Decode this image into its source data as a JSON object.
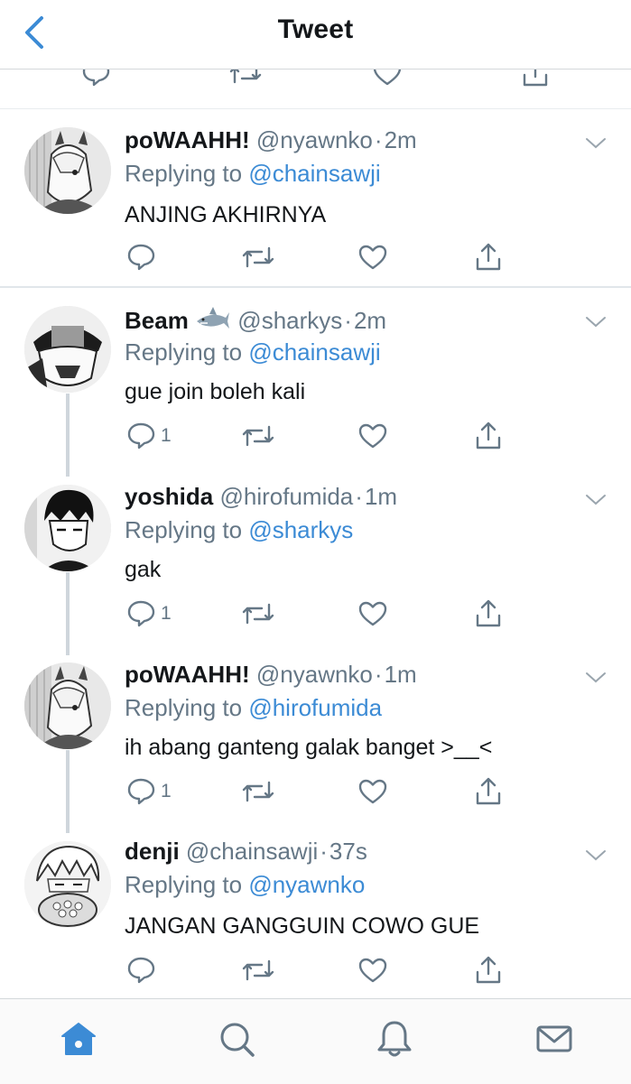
{
  "header": {
    "title": "Tweet"
  },
  "tweets": [
    {
      "name": "poWAAHH!",
      "emoji": "",
      "handle": "@nyawnko",
      "time": "2m",
      "replying_prefix": "Replying to",
      "replying_to": "@chainsawji",
      "text": "ANJING AKHIRNYA",
      "reply_count": ""
    },
    {
      "name": "Beam",
      "emoji": "shark-emoji",
      "handle": "@sharkys",
      "time": "2m",
      "replying_prefix": "Replying to",
      "replying_to": "@chainsawji",
      "text": "gue join boleh kali",
      "reply_count": "1"
    },
    {
      "name": "yoshida",
      "emoji": "",
      "handle": "@hirofumida",
      "time": "1m",
      "replying_prefix": "Replying to",
      "replying_to": "@sharkys",
      "text": "gak",
      "reply_count": "1"
    },
    {
      "name": "poWAAHH!",
      "emoji": "",
      "handle": "@nyawnko",
      "time": "1m",
      "replying_prefix": "Replying to",
      "replying_to": "@hirofumida",
      "text": "ih abang ganteng galak banget >__<",
      "reply_count": "1"
    },
    {
      "name": "denji",
      "emoji": "",
      "handle": "@chainsawji",
      "time": "37s",
      "replying_prefix": "Replying to",
      "replying_to": "@nyawnko",
      "text": "JANGAN GANGGUIN COWO GUE",
      "reply_count": ""
    }
  ],
  "icons": {
    "back": "chevron-left-icon",
    "more": "chevron-down-icon",
    "reply": "comment-icon",
    "retweet": "retweet-icon",
    "like": "heart-icon",
    "share": "share-icon",
    "tabs": [
      "home-icon",
      "search-icon",
      "bell-icon",
      "mail-icon"
    ]
  },
  "colors": {
    "accent": "#3c8bd5",
    "muted": "#657786",
    "text": "#14171a",
    "border": "#e1e6ea"
  }
}
